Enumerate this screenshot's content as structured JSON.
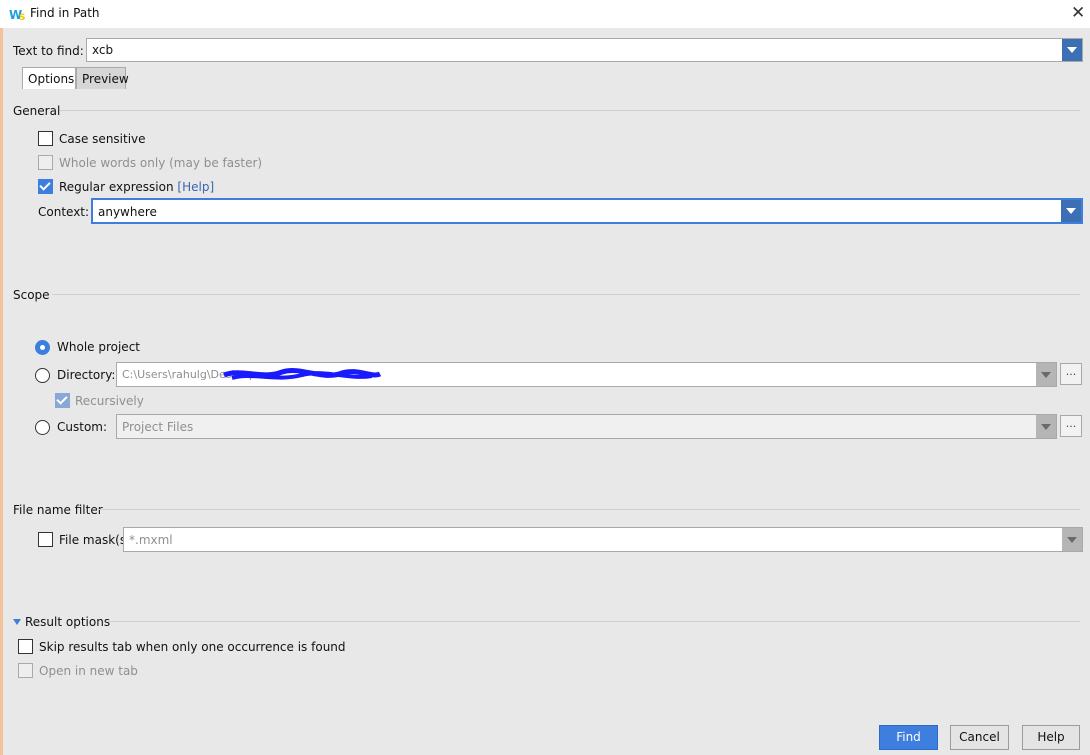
{
  "window": {
    "title": "Find in Path",
    "close_glyph": "✕"
  },
  "text_to_find": {
    "label": "Text to find:",
    "value": "xcb"
  },
  "tabs": [
    {
      "label": "Options",
      "active": true
    },
    {
      "label": "Preview",
      "active": false
    }
  ],
  "general": {
    "title": "General",
    "case_sensitive": {
      "label": "Case sensitive",
      "checked": false,
      "enabled": true
    },
    "whole_words": {
      "label": "Whole words only (may be faster)",
      "checked": false,
      "enabled": false
    },
    "regex": {
      "label": "Regular expression",
      "help": "[Help]",
      "checked": true,
      "enabled": true
    },
    "context": {
      "label": "Context:",
      "value": "anywhere"
    }
  },
  "scope": {
    "title": "Scope",
    "whole_project": {
      "label": "Whole project",
      "selected": true
    },
    "directory": {
      "label": "Directory:",
      "value": "C:\\Users\\rahulg\\Desktop",
      "more": "..."
    },
    "recursively": {
      "label": "Recursively",
      "checked": true,
      "enabled": false
    },
    "custom": {
      "label": "Custom:",
      "value": "Project Files",
      "more": "..."
    }
  },
  "file_filter": {
    "title": "File name filter",
    "file_mask": {
      "label": "File mask(s)",
      "placeholder": "*.mxml",
      "checked": false
    }
  },
  "result_options": {
    "title": "Result options",
    "skip_results": {
      "label": "Skip results tab when only one occurrence is found",
      "checked": false
    },
    "open_new_tab": {
      "label": "Open in new tab",
      "checked": false,
      "enabled": false
    }
  },
  "buttons": {
    "find": "Find",
    "cancel": "Cancel",
    "help": "Help"
  },
  "colors": {
    "accent": "#3d7ede",
    "background": "#e8e8e8",
    "link": "#3a67b0"
  }
}
